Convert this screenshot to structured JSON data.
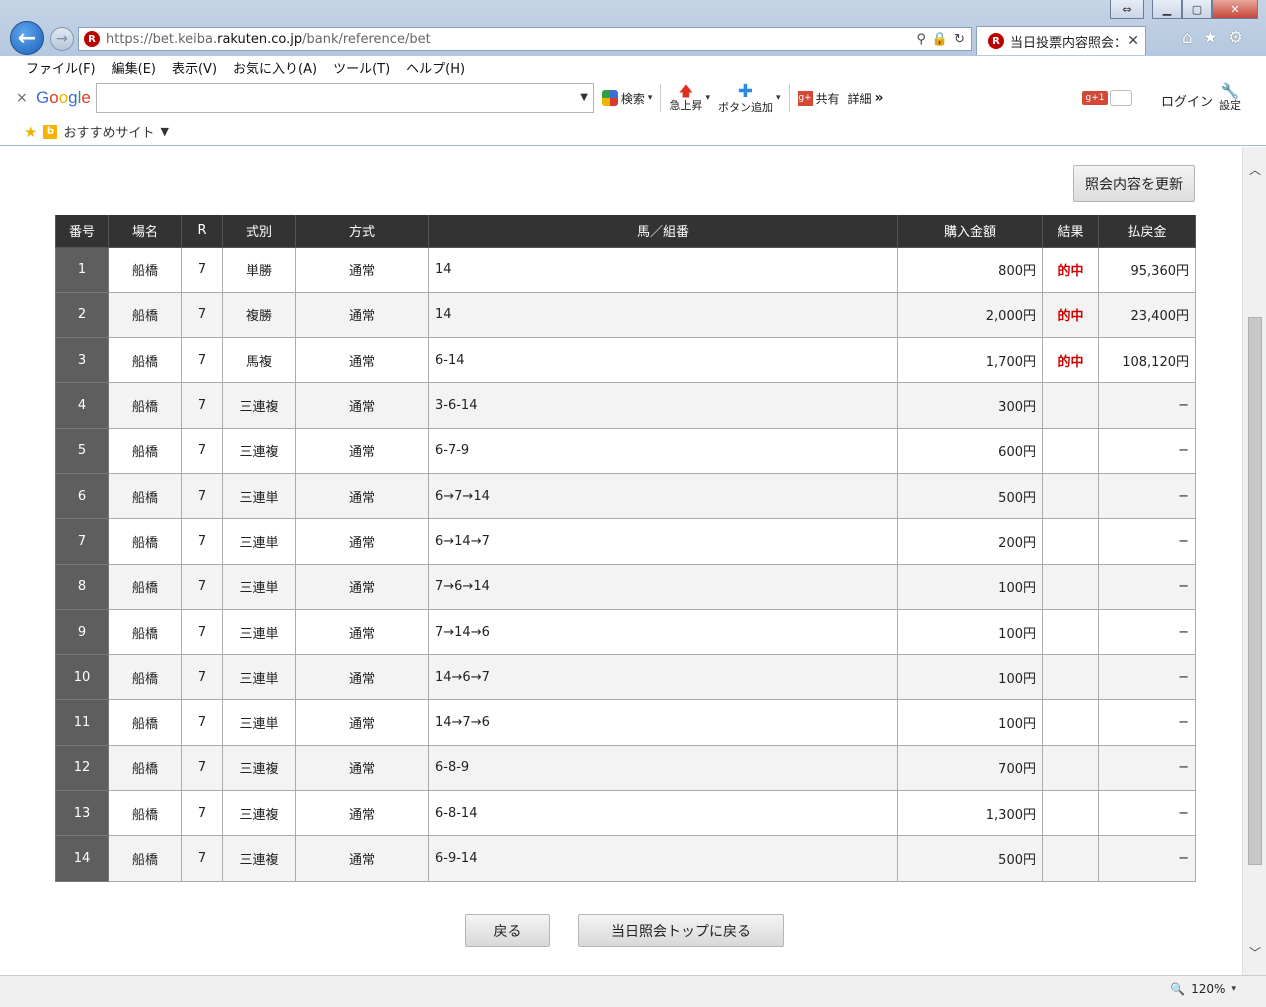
{
  "browser": {
    "url_prefix": "https://bet.keiba.",
    "url_domain": "rakuten.co.jp",
    "url_path": "/bank/reference/bet",
    "tab_title": "当日投票内容照会：...",
    "site_badge": "R"
  },
  "menu": [
    "ファイル(F)",
    "編集(E)",
    "表示(V)",
    "お気に入り(A)",
    "ツール(T)",
    "ヘルプ(H)"
  ],
  "google_bar": {
    "close": "×",
    "logo": [
      "G",
      "o",
      "o",
      "g",
      "l",
      "e"
    ],
    "search_label": "検索",
    "rising_label": "急上昇",
    "add_button_label": "ボタン追加",
    "share_label": "共有",
    "details_label": "詳細",
    "more": "»",
    "gplus": "g+1",
    "login": "ログイン",
    "settings": "設定"
  },
  "favorites": {
    "bing": "b",
    "label": "おすすめサイト"
  },
  "page": {
    "refresh_button": "照会内容を更新",
    "back_button": "戻る",
    "top_button": "当日照会トップに戻る"
  },
  "table": {
    "headers": [
      "番号",
      "場名",
      "R",
      "式別",
      "方式",
      "馬／組番",
      "購入金額",
      "結果",
      "払戻金"
    ],
    "rows": [
      {
        "no": "1",
        "venue": "船橋",
        "race": "7",
        "type": "単勝",
        "method": "通常",
        "combo": "14",
        "amount": "800円",
        "result": "的中",
        "payout": "95,360円"
      },
      {
        "no": "2",
        "venue": "船橋",
        "race": "7",
        "type": "複勝",
        "method": "通常",
        "combo": "14",
        "amount": "2,000円",
        "result": "的中",
        "payout": "23,400円"
      },
      {
        "no": "3",
        "venue": "船橋",
        "race": "7",
        "type": "馬複",
        "method": "通常",
        "combo": "6-14",
        "amount": "1,700円",
        "result": "的中",
        "payout": "108,120円"
      },
      {
        "no": "4",
        "venue": "船橋",
        "race": "7",
        "type": "三連複",
        "method": "通常",
        "combo": "3-6-14",
        "amount": "300円",
        "result": "",
        "payout": "−"
      },
      {
        "no": "5",
        "venue": "船橋",
        "race": "7",
        "type": "三連複",
        "method": "通常",
        "combo": "6-7-9",
        "amount": "600円",
        "result": "",
        "payout": "−"
      },
      {
        "no": "6",
        "venue": "船橋",
        "race": "7",
        "type": "三連単",
        "method": "通常",
        "combo": "6→7→14",
        "amount": "500円",
        "result": "",
        "payout": "−"
      },
      {
        "no": "7",
        "venue": "船橋",
        "race": "7",
        "type": "三連単",
        "method": "通常",
        "combo": "6→14→7",
        "amount": "200円",
        "result": "",
        "payout": "−"
      },
      {
        "no": "8",
        "venue": "船橋",
        "race": "7",
        "type": "三連単",
        "method": "通常",
        "combo": "7→6→14",
        "amount": "100円",
        "result": "",
        "payout": "−"
      },
      {
        "no": "9",
        "venue": "船橋",
        "race": "7",
        "type": "三連単",
        "method": "通常",
        "combo": "7→14→6",
        "amount": "100円",
        "result": "",
        "payout": "−"
      },
      {
        "no": "10",
        "venue": "船橋",
        "race": "7",
        "type": "三連単",
        "method": "通常",
        "combo": "14→6→7",
        "amount": "100円",
        "result": "",
        "payout": "−"
      },
      {
        "no": "11",
        "venue": "船橋",
        "race": "7",
        "type": "三連単",
        "method": "通常",
        "combo": "14→7→6",
        "amount": "100円",
        "result": "",
        "payout": "−"
      },
      {
        "no": "12",
        "venue": "船橋",
        "race": "7",
        "type": "三連複",
        "method": "通常",
        "combo": "6-8-9",
        "amount": "700円",
        "result": "",
        "payout": "−"
      },
      {
        "no": "13",
        "venue": "船橋",
        "race": "7",
        "type": "三連複",
        "method": "通常",
        "combo": "6-8-14",
        "amount": "1,300円",
        "result": "",
        "payout": "−"
      },
      {
        "no": "14",
        "venue": "船橋",
        "race": "7",
        "type": "三連複",
        "method": "通常",
        "combo": "6-9-14",
        "amount": "500円",
        "result": "",
        "payout": "−"
      }
    ]
  },
  "status": {
    "zoom": "120%"
  },
  "colors": {
    "hit": "#d00000",
    "header_bg": "#333333",
    "number_cell_bg": "#5e5e5e"
  },
  "icons": {
    "back": "back-arrow-icon",
    "forward": "forward-arrow-icon",
    "search": "search-icon",
    "lock": "lock-icon",
    "refresh": "refresh-icon",
    "home": "home-icon",
    "favorites": "star-icon",
    "tools": "gear-icon",
    "zoom": "zoom-icon"
  }
}
